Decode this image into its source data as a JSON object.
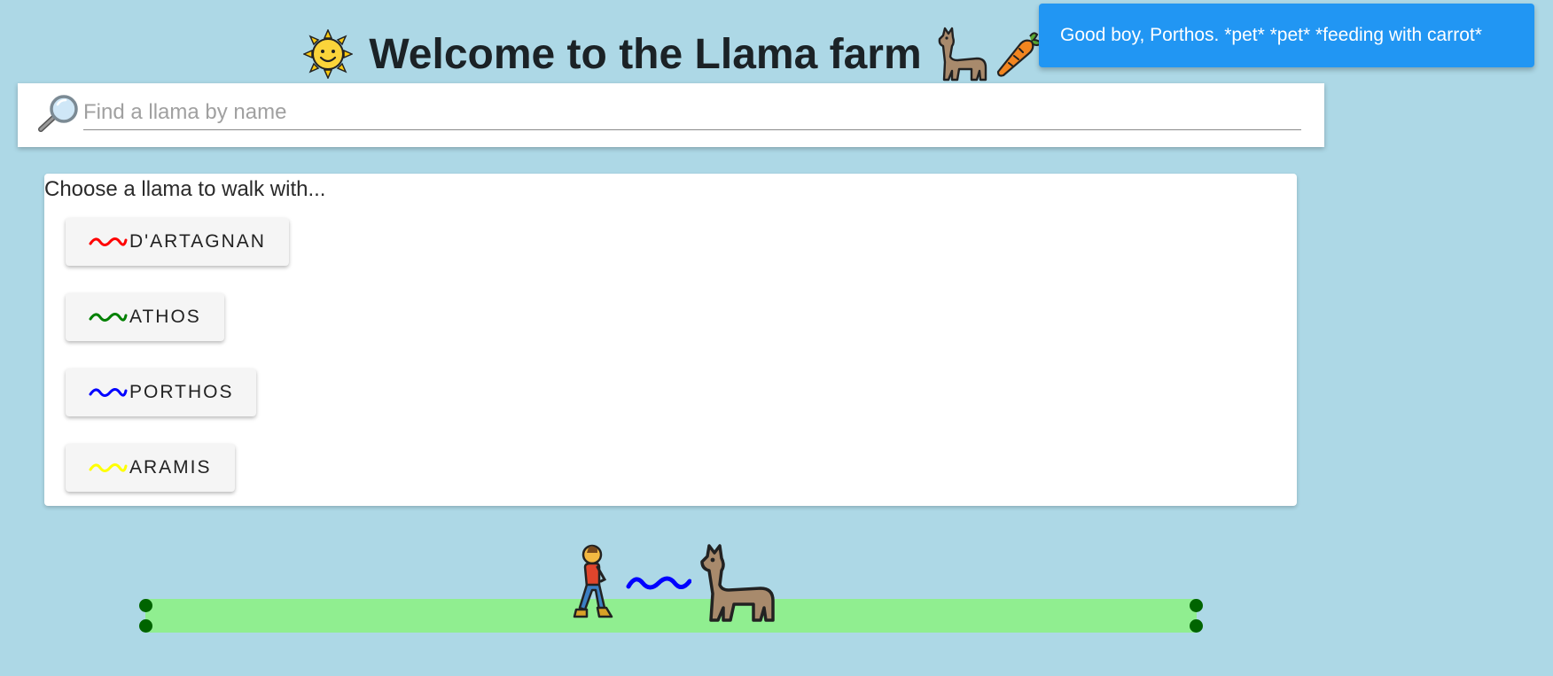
{
  "header": {
    "title": "Welcome to the Llama farm",
    "left_icon": "sun-icon",
    "right_icons": [
      "llama-icon",
      "carrot-icon"
    ]
  },
  "toast": {
    "message": "Good boy, Porthos. *pet* *pet* *feeding with carrot*",
    "color": "#2196f3"
  },
  "search": {
    "icon": "magnifier-icon",
    "placeholder": "Find a llama by name",
    "value": ""
  },
  "chooser": {
    "prompt": "Choose a llama to walk with...",
    "llamas": [
      {
        "label": "D'ARTAGNAN",
        "color": "#ff0000"
      },
      {
        "label": "ATHOS",
        "color": "#008000"
      },
      {
        "label": "PORTHOS",
        "color": "#0000ff"
      },
      {
        "label": "ARAMIS",
        "color": "#ffff00"
      }
    ]
  },
  "walk": {
    "walker_icon": "person-walking-icon",
    "leash_color": "#0000ff",
    "llama_icon": "llama-icon",
    "path_color": "#90ee90",
    "endpoint_color": "#006400"
  },
  "colors": {
    "background": "#add8e6"
  }
}
